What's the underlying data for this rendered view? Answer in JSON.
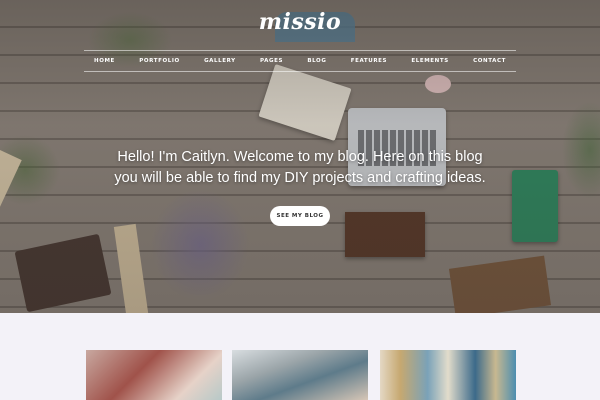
{
  "site": {
    "logo": "missio"
  },
  "nav": {
    "items": [
      {
        "label": "HOME"
      },
      {
        "label": "PORTFOLIO"
      },
      {
        "label": "GALLERY"
      },
      {
        "label": "PAGES"
      },
      {
        "label": "BLOG"
      },
      {
        "label": "FEATURES"
      },
      {
        "label": "ELEMENTS"
      },
      {
        "label": "CONTACT"
      }
    ]
  },
  "hero": {
    "headline_line1": "Hello! I'm Caitlyn. Welcome to my blog. Here on this blog",
    "headline_line2": "you will be able to find my DIY projects and crafting ideas.",
    "cta_label": "SEE MY BLOG"
  },
  "colors": {
    "background": "#f3f2f8",
    "nav_text": "#ffffff",
    "cta_bg": "#ffffff"
  }
}
